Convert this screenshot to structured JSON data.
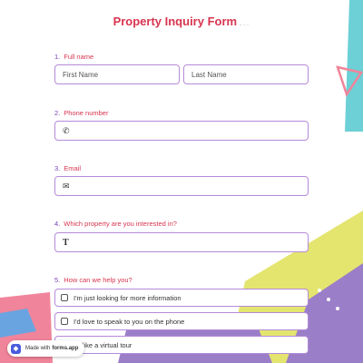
{
  "form": {
    "title": "Property Inquiry Form",
    "title_dots": "..."
  },
  "questions": [
    {
      "number": "1.",
      "label": "Full name"
    },
    {
      "number": "2.",
      "label": "Phone number"
    },
    {
      "number": "3.",
      "label": "Email"
    },
    {
      "number": "4.",
      "label": "Which property are you interested in?"
    },
    {
      "number": "5.",
      "label": "How can we help you?"
    }
  ],
  "fields": {
    "first_name_placeholder": "First Name",
    "last_name_placeholder": "Last Name",
    "phone_icon": "phone-icon",
    "email_icon": "envelope-icon",
    "property_icon": "text-icon"
  },
  "options": [
    {
      "label": "I'm just looking for more information"
    },
    {
      "label": "I'd love to speak to you on the phone"
    },
    {
      "label": "I'd like a virtual tour"
    }
  ],
  "badge": {
    "made_with": "Made with",
    "brand": "forms.app"
  },
  "colors": {
    "accent": "#d8344f",
    "number": "#7a3db8",
    "border": "#b58ad9",
    "bg_purple": "#9b7ec8",
    "bg_yellow": "#e3e56f",
    "bg_pink": "#f0849a",
    "bg_teal": "#6dd0d6"
  }
}
